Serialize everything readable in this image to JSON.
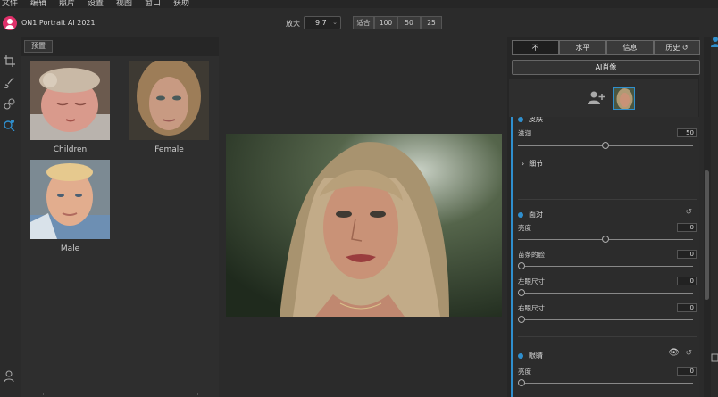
{
  "menu": [
    "文件",
    "编辑",
    "照片",
    "设置",
    "视图",
    "窗口",
    "获助"
  ],
  "app_title": "ON1 Portrait AI 2021",
  "toolbar": {
    "zoom_label": "放大",
    "zoom_value": "9.7",
    "fit_label": "适合",
    "zoom_presets": [
      "100",
      "50",
      "25"
    ]
  },
  "presets": {
    "button_label": "预置",
    "items": [
      {
        "label": "Children"
      },
      {
        "label": "Female"
      },
      {
        "label": "Male"
      }
    ]
  },
  "panel": {
    "tabs": [
      "不",
      "水平",
      "信息",
      "历史"
    ],
    "ai_button": "AI肖像",
    "section_top_partial": "皮肤",
    "smooth_label": "滋润",
    "smooth_value": "50",
    "detail_label": "细节",
    "face": {
      "title": "面对",
      "brightness_label": "亮度",
      "brightness_value": "0",
      "slim_label": "苗条的脸",
      "slim_value": "0",
      "left_eye_label": "左眼尺寸",
      "left_eye_value": "0",
      "right_eye_label": "右眼尺寸",
      "right_eye_value": "0"
    },
    "eyes": {
      "title": "眼睛",
      "brightness_label": "亮度",
      "brightness_value": "0"
    }
  },
  "colors": {
    "accent": "#2f8fce",
    "logo": "#e0306a"
  }
}
